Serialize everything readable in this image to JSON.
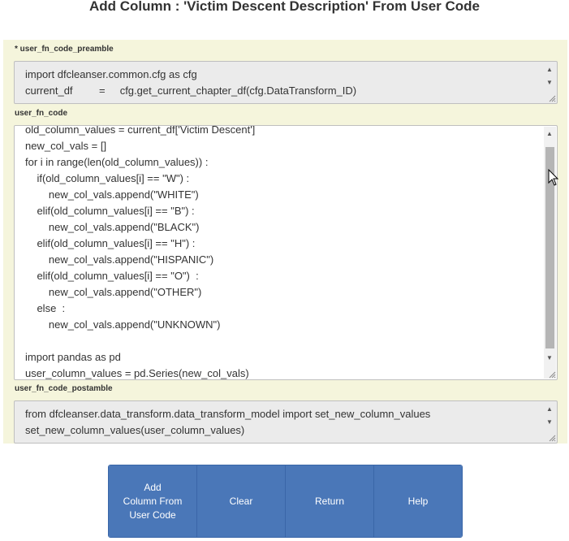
{
  "title": "Add Column : 'Victim Descent Description' From User Code",
  "preamble": {
    "label": "* user_fn_code_preamble",
    "lines": [
      "import dfcleanser.common.cfg as cfg",
      "current_df         =     cfg.get_current_chapter_df(cfg.DataTransform_ID)"
    ]
  },
  "code": {
    "label": "user_fn_code",
    "lines": [
      "old_column_values = current_df['Victim Descent']",
      "new_col_vals = []",
      "for i in range(len(old_column_values)) :",
      "    if(old_column_values[i] == \"W\") :",
      "        new_col_vals.append(\"WHITE\")",
      "    elif(old_column_values[i] == \"B\") :",
      "        new_col_vals.append(\"BLACK\")",
      "    elif(old_column_values[i] == \"H\") :",
      "        new_col_vals.append(\"HISPANIC\")",
      "    elif(old_column_values[i] == \"O\")  :",
      "        new_col_vals.append(\"OTHER\")",
      "    else  :",
      "        new_col_vals.append(\"UNKNOWN\")",
      "",
      "import pandas as pd",
      "user_column_values = pd.Series(new_col_vals)"
    ]
  },
  "postamble": {
    "label": "user_fn_code_postamble",
    "lines": [
      "from dfcleanser.data_transform.data_transform_model import set_new_column_values",
      "set_new_column_values(user_column_values)"
    ]
  },
  "buttons": [
    "Add\nColumn From\nUser Code",
    "Clear",
    "Return",
    "Help"
  ]
}
